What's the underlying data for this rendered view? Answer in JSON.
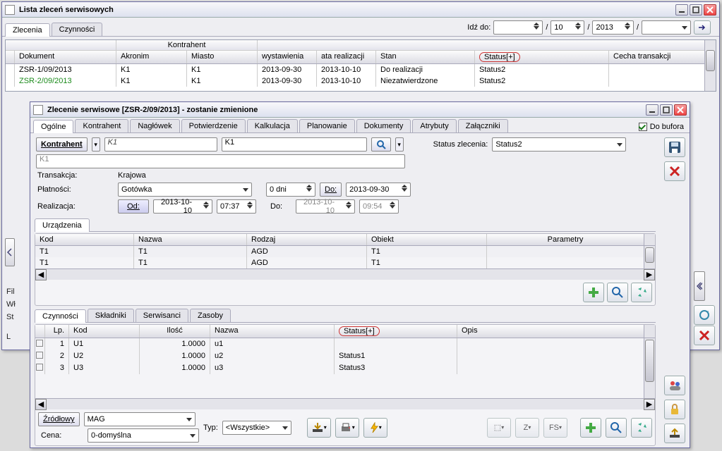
{
  "outer_window": {
    "title": "Lista zleceń serwisowych",
    "tabs": {
      "zlecenia": "Zlecenia",
      "czynnosci": "Czynności"
    },
    "goto_label": "Idź do:",
    "goto_page": "10",
    "goto_year": "2013",
    "columns": {
      "dokument": "Dokument",
      "kontrahent_super": "Kontrahent",
      "akronim": "Akronim",
      "miasto": "Miasto",
      "wystawienia": "wystawienia",
      "realizacji": "ata realizacji",
      "stan": "Stan",
      "status": "Status[+]",
      "cecha": "Cecha transakcji"
    },
    "rows": [
      {
        "dokument": "ZSR-1/09/2013",
        "akronim": "K1",
        "miasto": "K1",
        "wystawienia": "2013-09-30",
        "realizacji": "2013-10-10",
        "stan": "Do realizacji",
        "status": "Status2",
        "green": false
      },
      {
        "dokument": "ZSR-2/09/2013",
        "akronim": "K1",
        "miasto": "K1",
        "wystawienia": "2013-09-30",
        "realizacji": "2013-10-10",
        "stan": "Niezatwierdzone",
        "status": "Status2",
        "green": true
      }
    ]
  },
  "side_labels": {
    "fil": "Fil",
    "wl": "Wł",
    "st": "St",
    "l": "L"
  },
  "inner_window": {
    "title": "Zlecenie serwisowe [ZSR-2/09/2013]  - zostanie zmienione",
    "tabs": {
      "ogolne": "Ogólne",
      "kontrahent": "Kontrahent",
      "naglowek": "Nagłówek",
      "potwierdzenie": "Potwierdzenie",
      "kalkulacja": "Kalkulacja",
      "planowanie": "Planowanie",
      "dokumenty": "Dokumenty",
      "atrybuty": "Atrybuty",
      "zalaczniki": "Załączniki"
    },
    "do_bufora": "Do bufora",
    "kontrahent_btn": "Kontrahent",
    "kontrahent_val1": "K1",
    "kontrahent_val2": "K1",
    "kontrahent_line2": "K1",
    "status_lbl": "Status zlecenia:",
    "status_val": "Status2",
    "transakcja_lbl": "Transakcja:",
    "transakcja_val": "Krajowa",
    "platnosci_lbl": "Płatności:",
    "platnosci_val": "Gotówka",
    "dni_val": "0 dni",
    "do_btn": "Do:",
    "do_date": "2013-09-30",
    "realizacja_lbl": "Realizacja:",
    "od_btn": "Od:",
    "od_date": "2013-10-10",
    "od_time": "07:37",
    "do2_lbl": "Do:",
    "do2_date": "2013-10-10",
    "do2_time": "09:54",
    "urzadzenia_tab": "Urządzenia",
    "urz_cols": {
      "kod": "Kod",
      "nazwa": "Nazwa",
      "rodzaj": "Rodzaj",
      "obiekt": "Obiekt",
      "parametry": "Parametry"
    },
    "urz_rows": [
      {
        "kod": "T1",
        "nazwa": "T1",
        "rodzaj": "AGD",
        "obiekt": "T1"
      },
      {
        "kod": "T1",
        "nazwa": "T1",
        "rodzaj": "AGD",
        "obiekt": "T1"
      }
    ],
    "lower_tabs": {
      "czynnosci": "Czynności",
      "skladniki": "Składniki",
      "serwisanci": "Serwisanci",
      "zasoby": "Zasoby"
    },
    "czyn_cols": {
      "lp": "Lp.",
      "kod": "Kod",
      "ilosc": "Ilość",
      "nazwa": "Nazwa",
      "status": "Status[+]",
      "opis": "Opis"
    },
    "czyn_rows": [
      {
        "lp": "1",
        "kod": "U1",
        "ilosc": "1.0000",
        "nazwa": "u1",
        "status": ""
      },
      {
        "lp": "2",
        "kod": "U2",
        "ilosc": "1.0000",
        "nazwa": "u2",
        "status": "Status1"
      },
      {
        "lp": "3",
        "kod": "U3",
        "ilosc": "1.0000",
        "nazwa": "u3",
        "status": "Status3"
      }
    ],
    "zrodlowy_btn": "Źródłowy",
    "mag_val": "MAG",
    "typ_lbl": "Typ:",
    "typ_val": "<Wszystkie>",
    "cena_lbl": "Cena:",
    "cena_val": "0-domyślna"
  }
}
